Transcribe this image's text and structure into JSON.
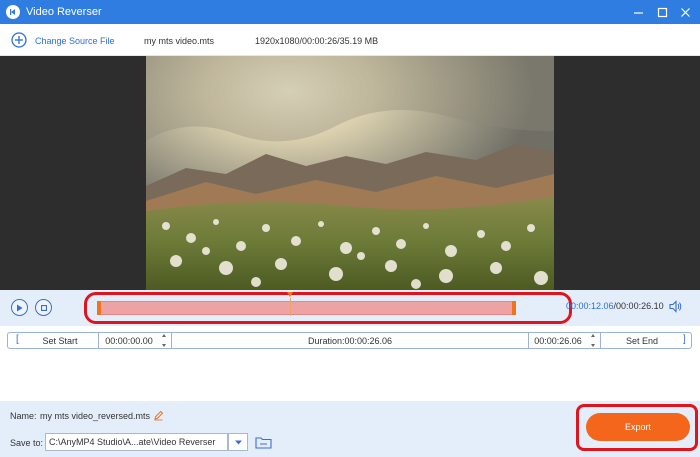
{
  "window": {
    "title": "Video Reverser",
    "icons": {
      "app": "reverse-play-icon",
      "minimize": "minimize-icon",
      "maximize": "maximize-icon",
      "close": "close-icon"
    }
  },
  "source": {
    "change_label": "Change Source File",
    "file_name": "my mts video.mts",
    "file_meta": "1920x1080/00:00:26/35.19 MB"
  },
  "player": {
    "current_time": "00:00:12.06",
    "total_time": "/00:00:26.10",
    "progress_fraction": 0.46,
    "icons": {
      "play": "play-icon",
      "stop": "stop-icon",
      "volume": "volume-icon"
    }
  },
  "clip": {
    "set_start_label": "Set Start",
    "start_time": "00:00:00.00",
    "duration": "Duration:00:00:26.06",
    "end_time": "00:00:26.06",
    "set_end_label": "Set End"
  },
  "output": {
    "name_label": "Name:",
    "name_value": "my mts video_reversed.mts",
    "save_label": "Save to:",
    "save_path": "C:\\AnyMP4 Studio\\A...ate\\Video Reverser",
    "export_label": "Export"
  },
  "colors": {
    "titlebar": "#2f7de1",
    "accent": "#2b6fd6",
    "export": "#f3661b",
    "highlight": "#e0141c"
  }
}
